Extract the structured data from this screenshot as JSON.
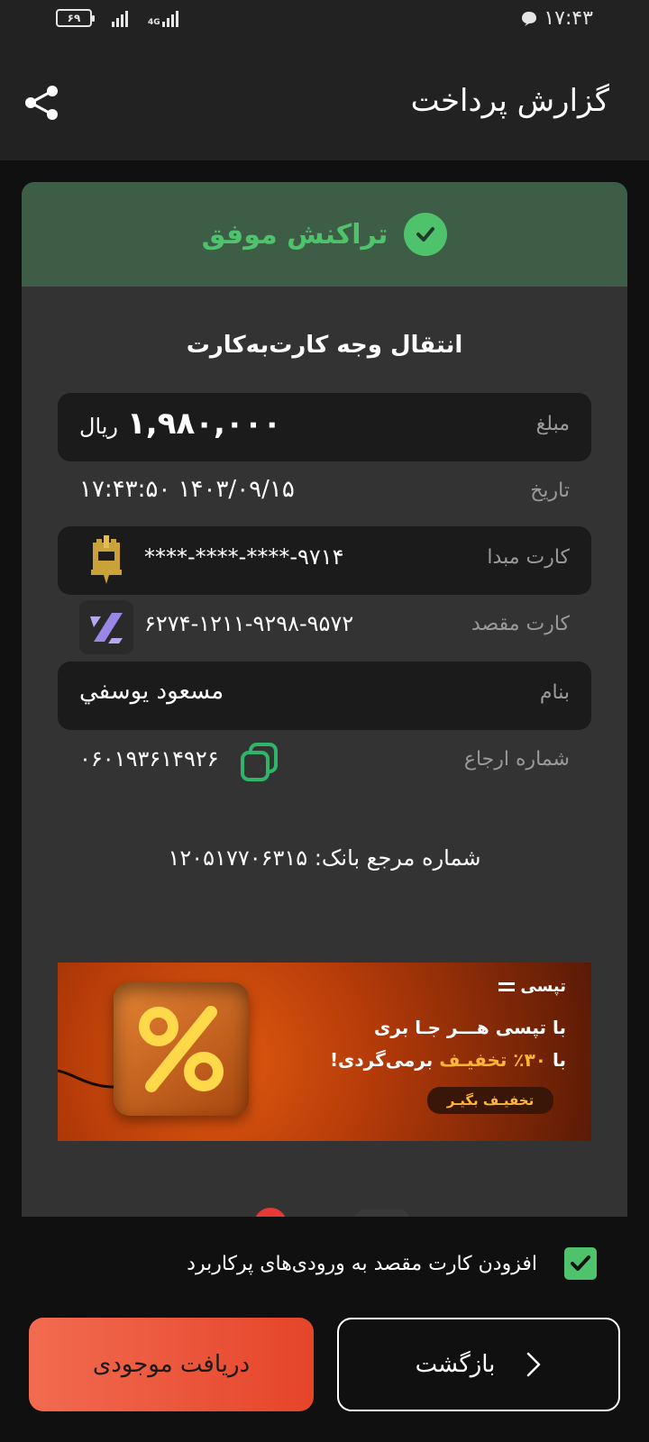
{
  "status_bar": {
    "time": "۱۷:۴۳",
    "battery": "۶۹",
    "network": "4G"
  },
  "app_bar": {
    "title": "گزارش پرداخت",
    "share_icon": "share-icon"
  },
  "receipt": {
    "status_text": "تراکنش موفق",
    "status_color": "#4fc26c",
    "transaction_type": "انتقال وجه کارت‌به‌کارت",
    "amount": {
      "label": "مبلغ",
      "value": "۱,۹۸۰,۰۰۰",
      "unit": "ریال"
    },
    "date": {
      "label": "تاریخ",
      "value": "۱۷:۴۳:۵۰ ۱۴۰۳/۰۹/۱۵"
    },
    "source_card": {
      "label": "کارت مبدا",
      "value": "****-****-****-۹۷۱۴",
      "bank_icon": "sepah-bank-logo"
    },
    "dest_card": {
      "label": "کارت مقصد",
      "value": "۶۲۷۴-۱۲۱۱-۹۲۹۸-۹۵۷۲",
      "bank_icon": "bank-logo"
    },
    "recipient": {
      "label": "بنام",
      "value": "مسعود يوسفي"
    },
    "reference": {
      "label": "شماره ارجاع",
      "value": "۰۶۰۱۹۳۶۱۴۹۲۶"
    },
    "bank_reference": "شماره مرجع بانک: ۱۲۰۵۱۷۷۰۶۳۱۵"
  },
  "banner": {
    "brand": "تپسی",
    "line1": "با تپسی هـــر جـا بری",
    "line2_prefix": "با",
    "line2_highlight": "۳۰٪ تخفیـف",
    "line2_suffix": "برمی‌گردی!",
    "cta": "تخفیـف بگیـر",
    "accent_color": "#ffb637"
  },
  "bottom": {
    "checkbox_label": "افزودن کارت مقصد به ورودی‌های پرکاربرد",
    "checkbox_checked": true,
    "back_button": "بازگشت",
    "balance_button": "دریافت موجودی",
    "balance_button_color": "#e5452a"
  }
}
